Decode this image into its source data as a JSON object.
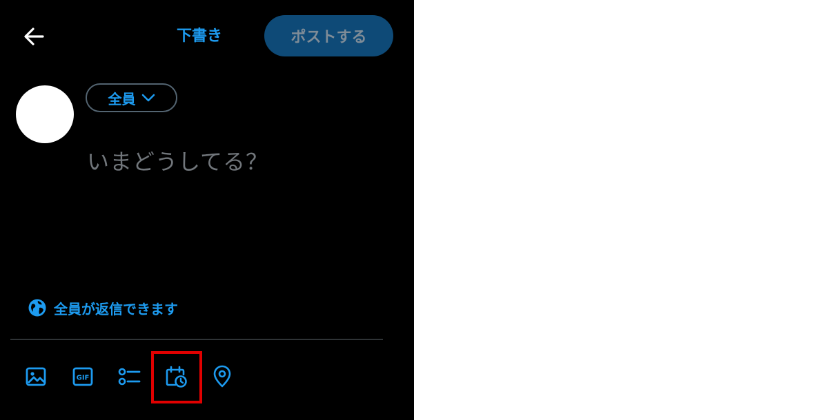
{
  "header": {
    "back_icon": "arrow-left-icon",
    "drafts_label": "下書き",
    "post_label": "ポストする"
  },
  "composer": {
    "audience_label": "全員",
    "audience_icon": "chevron-down-icon",
    "placeholder": "いまどうしてる？",
    "reply_setting_label": "全員が返信できます",
    "reply_setting_icon": "globe-icon"
  },
  "toolbar": {
    "items": [
      {
        "icon": "image-icon"
      },
      {
        "icon": "gif-icon",
        "label": "GIF"
      },
      {
        "icon": "poll-icon"
      },
      {
        "icon": "schedule-icon",
        "highlighted": true
      },
      {
        "icon": "location-icon"
      }
    ]
  },
  "colors": {
    "background": "#000000",
    "accent": "#1d9bf0",
    "post_button_bg": "#0e4a77",
    "post_button_text": "#7f8c97",
    "placeholder": "#71767b",
    "divider": "#2f3336",
    "highlight": "#e00000"
  }
}
